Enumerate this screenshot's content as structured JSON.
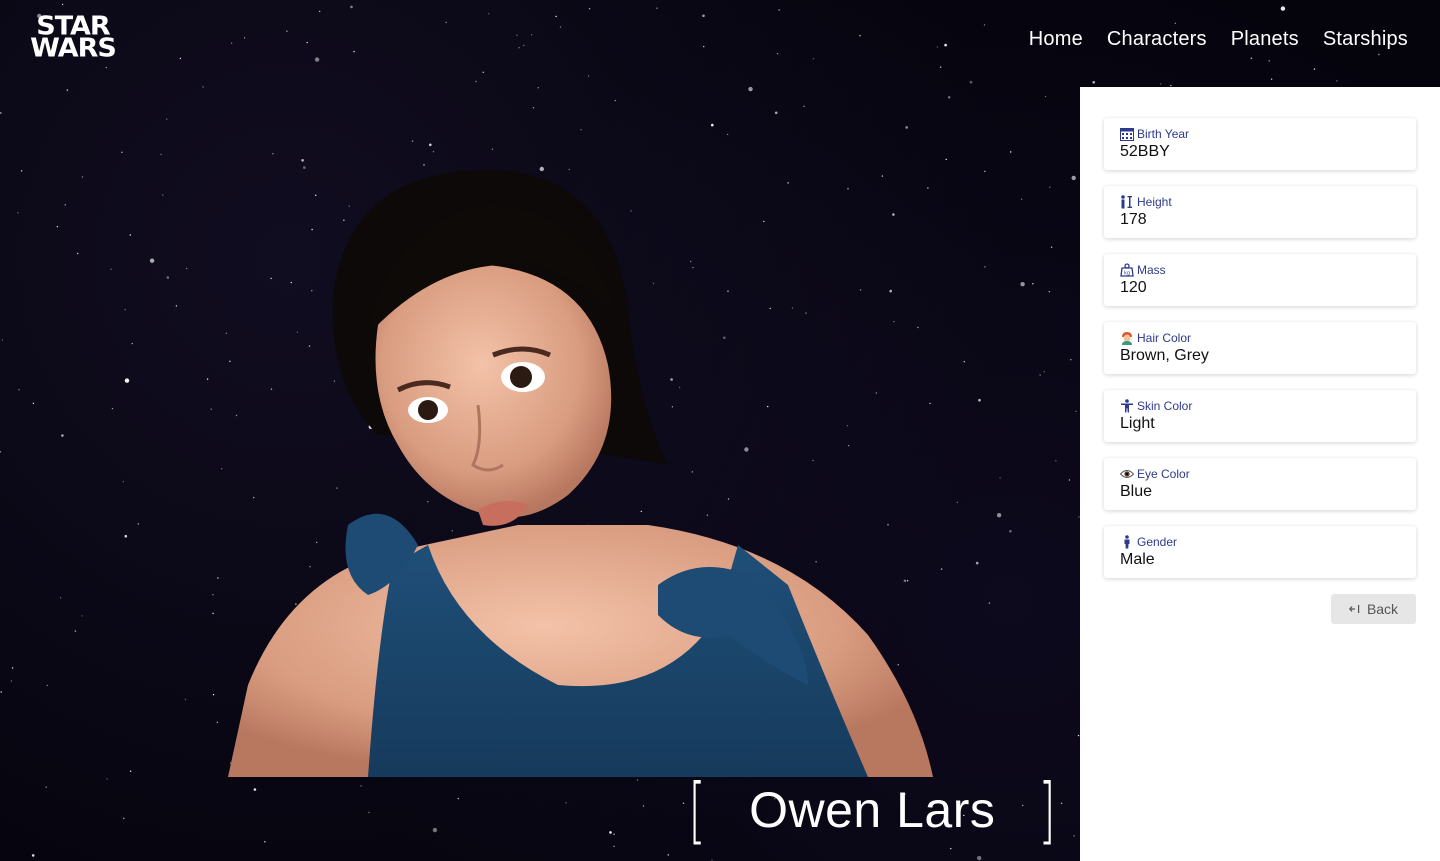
{
  "logo": {
    "line1": "STAR",
    "line2": "WARS"
  },
  "nav": [
    {
      "label": "Home"
    },
    {
      "label": "Characters"
    },
    {
      "label": "Planets"
    },
    {
      "label": "Starships"
    }
  ],
  "character": {
    "name": "Owen Lars",
    "bracket_open": "[",
    "bracket_close": "]"
  },
  "details": [
    {
      "icon": "calendar-icon",
      "label": "Birth Year",
      "value": "52BBY"
    },
    {
      "icon": "height-icon",
      "label": "Height",
      "value": "178"
    },
    {
      "icon": "weight-icon",
      "label": "Mass",
      "value": "120"
    },
    {
      "icon": "hair-icon",
      "label": "Hair Color",
      "value": "Brown, Grey"
    },
    {
      "icon": "person-icon",
      "label": "Skin Color",
      "value": "Light"
    },
    {
      "icon": "eye-icon",
      "label": "Eye Color",
      "value": "Blue"
    },
    {
      "icon": "male-icon",
      "label": "Gender",
      "value": "Male"
    }
  ],
  "back_button": {
    "label": "Back",
    "icon": "back-arrow-icon"
  },
  "colors": {
    "label_blue": "#2e3a8c",
    "background_space": "#05040d",
    "panel": "#ffffff"
  }
}
